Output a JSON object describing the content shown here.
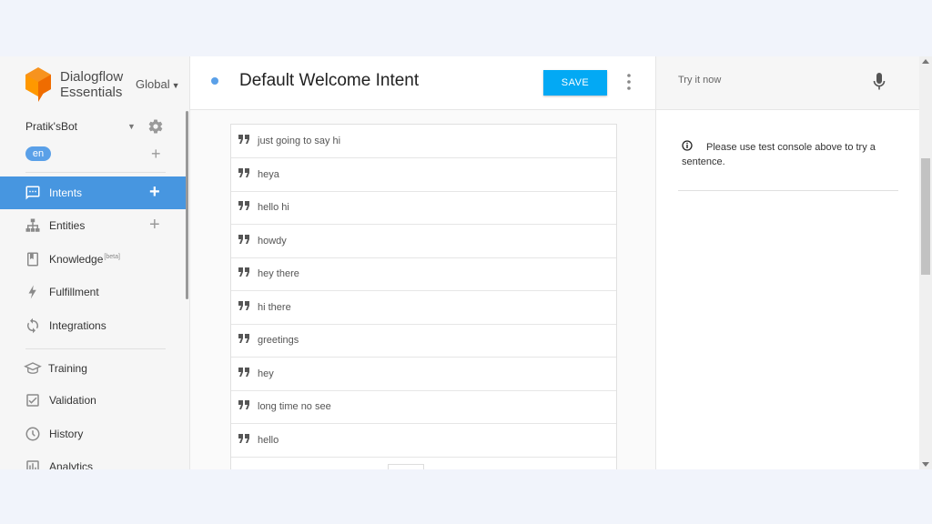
{
  "brand": {
    "line1": "Dialogflow",
    "line2": "Essentials",
    "region": "Global"
  },
  "agent": {
    "name": "Pratik'sBot",
    "language": "en"
  },
  "nav": {
    "intents": "Intents",
    "entities": "Entities",
    "knowledge": "Knowledge",
    "knowledge_badge": "[beta]",
    "fulfillment": "Fulfillment",
    "integrations": "Integrations",
    "training": "Training",
    "validation": "Validation",
    "history": "History",
    "analytics": "Analytics"
  },
  "intent": {
    "title": "Default Welcome Intent",
    "save_label": "SAVE"
  },
  "training_phrases": [
    "just going to say hi",
    "heya",
    "hello hi",
    "howdy",
    "hey there",
    "hi there",
    "greetings",
    "hey",
    "long time no see",
    "hello"
  ],
  "test_console": {
    "placeholder": "Try it now",
    "info": "Please use test console above to try a sentence."
  },
  "colors": {
    "accent": "#4796e0",
    "save": "#03a9f4",
    "logo": "#f7931e"
  }
}
